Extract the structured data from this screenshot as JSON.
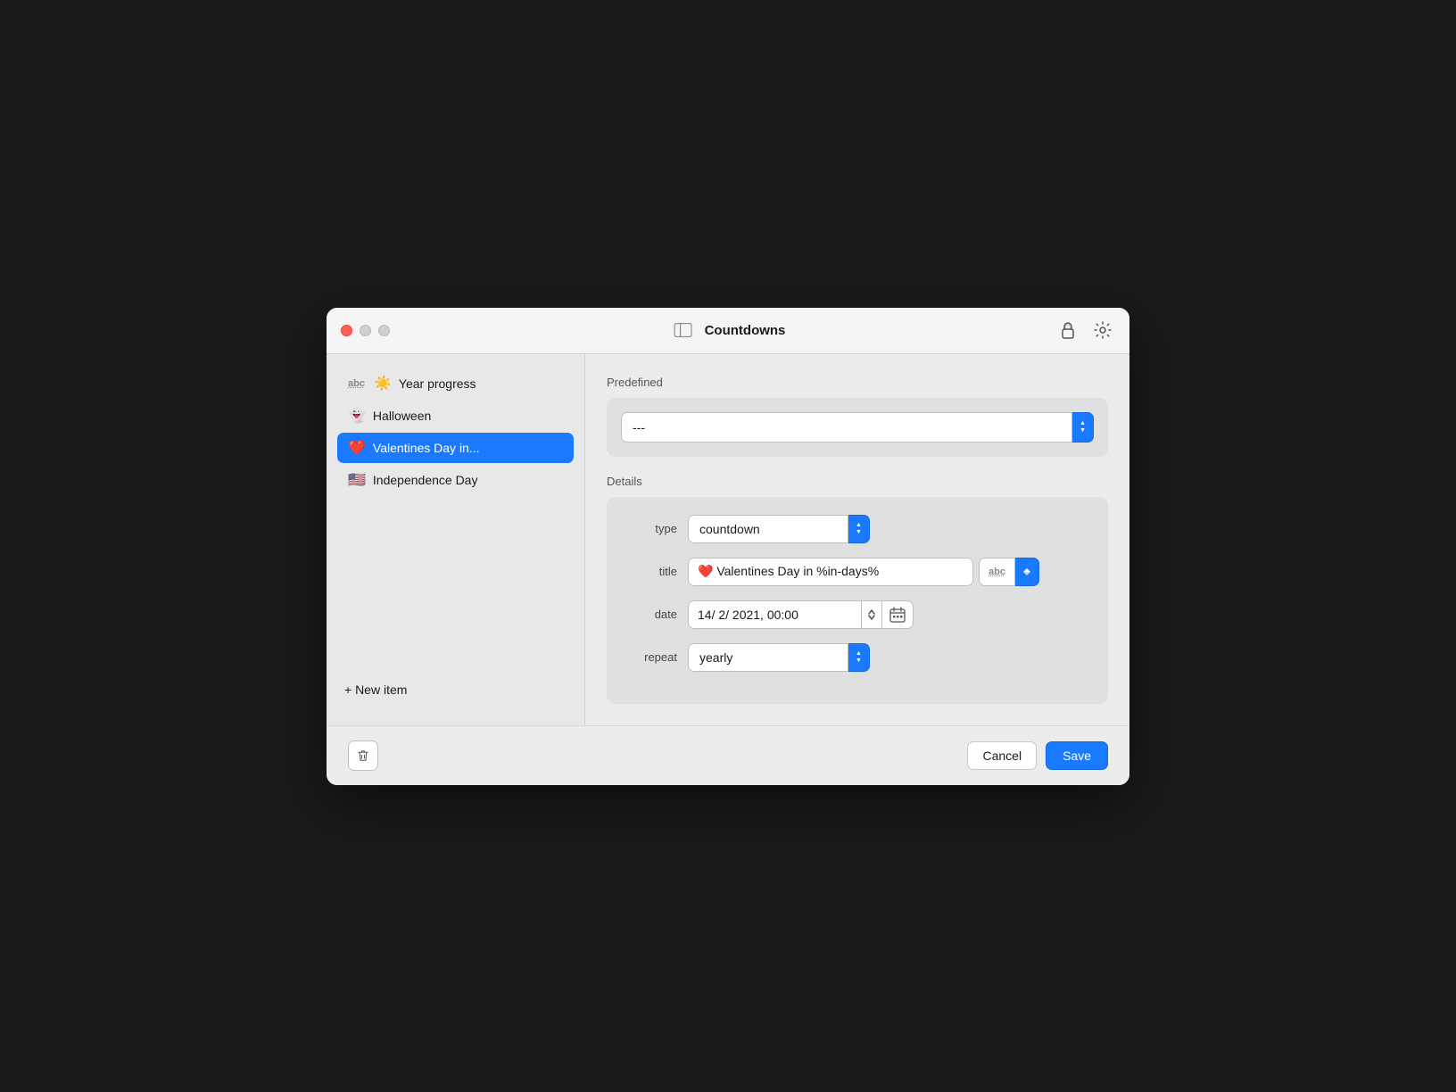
{
  "window": {
    "title": "Countdowns"
  },
  "sidebar": {
    "items": [
      {
        "id": "year-progress",
        "emoji": "☀️",
        "label": "Year progress",
        "hasAbc": true,
        "active": false
      },
      {
        "id": "halloween",
        "emoji": "👻",
        "label": "Halloween",
        "hasAbc": false,
        "active": false
      },
      {
        "id": "valentines-day",
        "emoji": "❤️",
        "label": "Valentines Day in...",
        "hasAbc": false,
        "active": true
      },
      {
        "id": "independence-day",
        "emoji": "🇺🇸",
        "label": "Independence Day",
        "hasAbc": false,
        "active": false
      }
    ],
    "new_item_label": "+ New item"
  },
  "predefined": {
    "label": "Predefined",
    "dropdown_value": "---"
  },
  "details": {
    "label": "Details",
    "type_label": "type",
    "type_value": "countdown",
    "title_label": "title",
    "title_value": "❤️ Valentines Day in %in-days%",
    "date_label": "date",
    "date_value": "14/ 2/ 2021, 00:00",
    "repeat_label": "repeat",
    "repeat_value": "yearly"
  },
  "buttons": {
    "cancel_label": "Cancel",
    "save_label": "Save"
  },
  "icons": {
    "sidebar_toggle": "⊟",
    "lock": "🔓",
    "gear": "⚙️",
    "delete": "🗑",
    "calendar": "📅"
  }
}
